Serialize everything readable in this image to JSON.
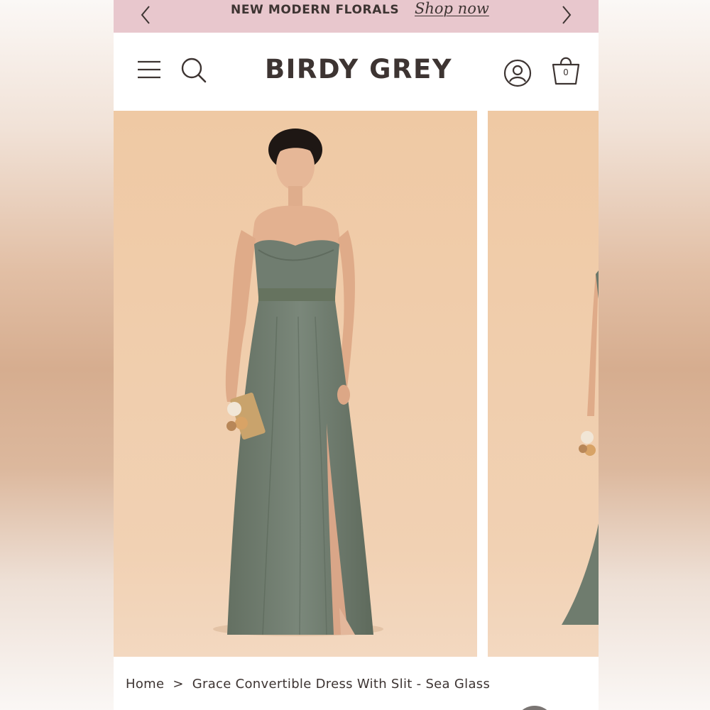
{
  "promo": {
    "text": "NEW MODERN FLORALS",
    "link": "Shop now",
    "background": "#e8c7cd",
    "prev_icon": "chevron-left-icon",
    "next_icon": "chevron-right-icon"
  },
  "header": {
    "logo": "BIRDY GREY",
    "menu_icon": "hamburger-menu-icon",
    "search_icon": "search-icon",
    "account_icon": "account-icon",
    "bag_icon": "shopping-bag-icon",
    "bag_count": "0",
    "text_color": "#3d3432"
  },
  "gallery": {
    "background_color": "#efcaa6",
    "dress_color": "#6f7c6e"
  },
  "breadcrumb": {
    "home": "Home",
    "separator": ">",
    "current": "Grace Convertible Dress With Slit - Sea Glass"
  }
}
